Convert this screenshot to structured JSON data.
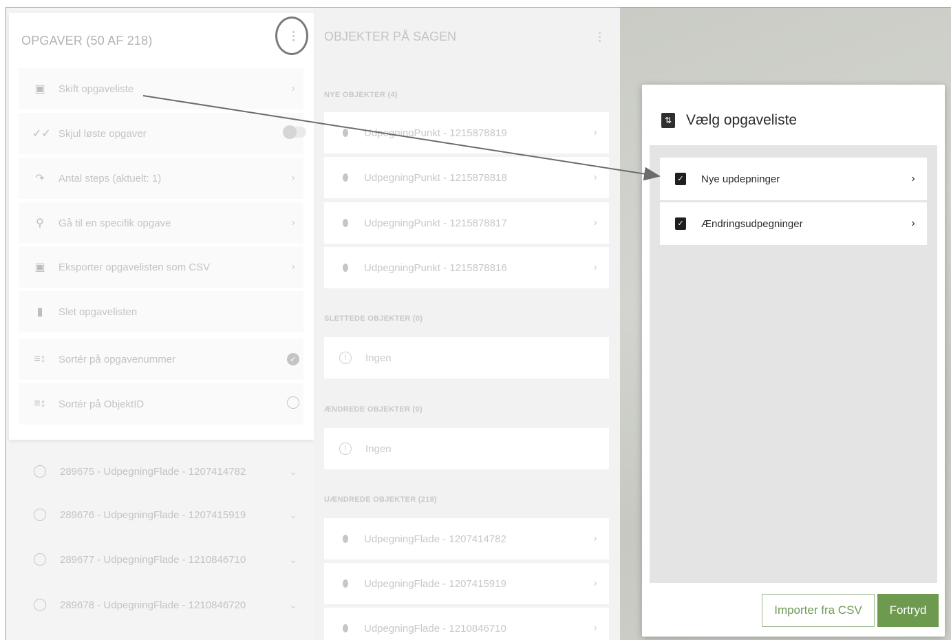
{
  "left_panel": {
    "header": "OPGAVER (50 AF 218)",
    "menu": [
      {
        "label": "Skift opgaveliste",
        "icon": "switch-list-icon",
        "right": "›"
      },
      {
        "label": "Skjul løste opgaver",
        "icon": "double-check-icon",
        "right": "toggle"
      },
      {
        "label": "Antal steps (aktuelt: 1)",
        "icon": "steps-icon",
        "right": "›"
      },
      {
        "label": "Gå til en specifik opgave",
        "icon": "search-icon",
        "right": "›"
      },
      {
        "label": "Eksporter opgavelisten som CSV",
        "icon": "export-icon",
        "right": "›"
      },
      {
        "label": "Slet opgavelisten",
        "icon": "trash-icon",
        "right": ""
      },
      {
        "label": "Sortér på opgavenummer",
        "icon": "sort-icon",
        "right": "checked"
      },
      {
        "label": "Sortér på ObjektID",
        "icon": "sort-icon",
        "right": "unchecked"
      }
    ],
    "tasks": [
      "289675 - UdpegningFlade - 1207414782",
      "289676 - UdpegningFlade - 1207415919",
      "289677 - UdpegningFlade - 1210846710",
      "289678 - UdpegningFlade - 1210846720"
    ]
  },
  "middle_panel": {
    "header": "OBJEKTER PÅ SAGEN",
    "sections": {
      "new": {
        "title": "NYE OBJEKTER (4)",
        "items": [
          "UdpegningPunkt - 1215878819",
          "UdpegningPunkt - 1215878818",
          "UdpegningPunkt - 1215878817",
          "UdpegningPunkt - 1215878816"
        ]
      },
      "deleted": {
        "title": "SLETTEDE OBJEKTER (0)",
        "items": [
          "Ingen"
        ]
      },
      "changed": {
        "title": "ÆNDREDE OBJEKTER (0)",
        "items": [
          "Ingen"
        ]
      },
      "unchanged": {
        "title": "UÆNDREDE OBJEKTER (218)",
        "items": [
          "UdpegningFlade - 1207414782",
          "UdpegningFlade - 1207415919",
          "UdpegningFlade - 1210846710"
        ]
      }
    }
  },
  "dialog": {
    "title": "Vælg opgaveliste",
    "options": [
      "Nye updepninger",
      "Ændringsudpegninger"
    ],
    "import_button": "Importer fra CSV",
    "cancel_button": "Fortryd"
  },
  "colors": {
    "accent_green": "#6d9a4f",
    "highlight_ring": "#7a7a7a"
  }
}
